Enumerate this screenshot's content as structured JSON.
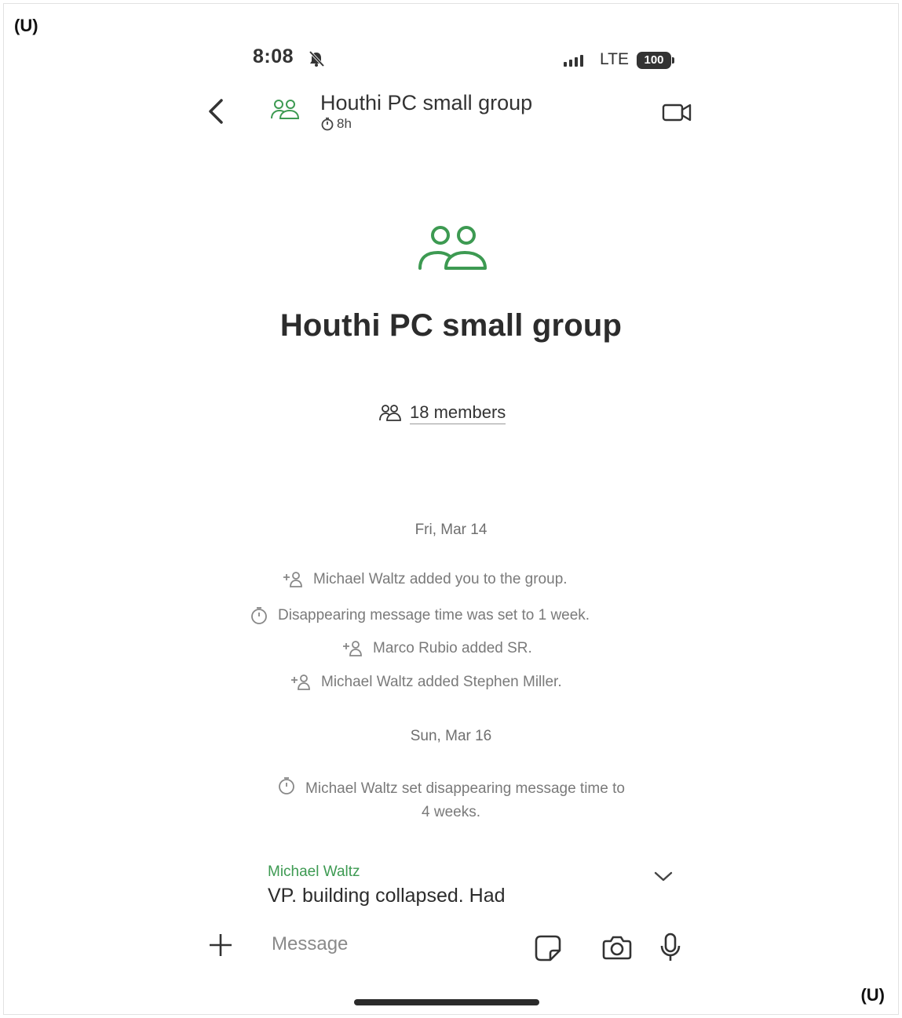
{
  "classification_marks": {
    "top_left": "(U)",
    "bottom_right": "(U)"
  },
  "status_bar": {
    "time": "8:08",
    "network": "LTE",
    "battery": "100"
  },
  "header": {
    "title": "Houthi PC small group",
    "timer": "8h"
  },
  "group_info": {
    "title": "Houthi PC small group",
    "members": "18 members"
  },
  "timeline": {
    "date1": "Fri, Mar 14",
    "events1": [
      "Michael Waltz added you to the group.",
      "Disappearing message time was set to 1 week.",
      "Marco Rubio added SR.",
      "Michael Waltz added Stephen Miller."
    ],
    "date2": "Sun, Mar 16",
    "event2_line1": "Michael Waltz set disappearing message time to",
    "event2_line2": "4 weeks."
  },
  "message": {
    "sender": "Michael Waltz",
    "text": "VP.  building collapsed. Had"
  },
  "composer": {
    "placeholder": "Message"
  },
  "colors": {
    "accent_green": "#3d9a52",
    "text_dark": "#2c2c2c",
    "text_muted": "#7a7a7a"
  },
  "icons": [
    "bell-off-icon",
    "signal-icon",
    "battery-icon",
    "back-chevron-icon",
    "group-icon",
    "timer-icon",
    "video-call-icon",
    "members-icon",
    "add-person-icon",
    "chevron-down-icon",
    "plus-icon",
    "sticker-icon",
    "camera-icon",
    "microphone-icon"
  ]
}
